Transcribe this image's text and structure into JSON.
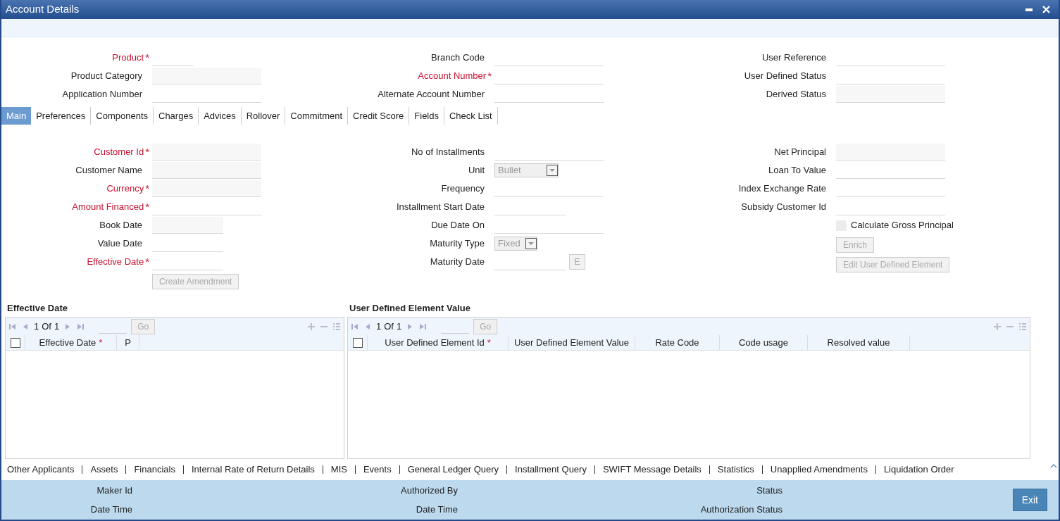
{
  "window": {
    "title": "Account Details"
  },
  "required_marker": "*",
  "header_fields": [
    [
      {
        "label": "Product",
        "required": true,
        "kind": "input"
      },
      {
        "label": "Product Category",
        "required": false,
        "kind": "readonly"
      },
      {
        "label": "Application Number",
        "required": false,
        "kind": "input"
      }
    ],
    [
      {
        "label": "Branch Code",
        "required": false,
        "kind": "input"
      },
      {
        "label": "Account Number",
        "required": true,
        "kind": "input"
      },
      {
        "label": "Alternate Account Number",
        "required": false,
        "kind": "input"
      }
    ],
    [
      {
        "label": "User Reference",
        "required": false,
        "kind": "input"
      },
      {
        "label": "User Defined Status",
        "required": false,
        "kind": "input"
      },
      {
        "label": "Derived Status",
        "required": false,
        "kind": "readonly"
      }
    ]
  ],
  "tabs": [
    {
      "label": "Main",
      "selected": true
    },
    {
      "label": "Preferences",
      "selected": false
    },
    {
      "label": "Components",
      "selected": false
    },
    {
      "label": "Charges",
      "selected": false
    },
    {
      "label": "Advices",
      "selected": false
    },
    {
      "label": "Rollover",
      "selected": false
    },
    {
      "label": "Commitment",
      "selected": false
    },
    {
      "label": "Credit Score",
      "selected": false
    },
    {
      "label": "Fields",
      "selected": false
    },
    {
      "label": "Check List",
      "selected": false
    }
  ],
  "main_fields": [
    [
      {
        "kind": "readonly",
        "label": "Customer Id",
        "required": true
      },
      {
        "kind": "readonly",
        "label": "Customer Name",
        "required": false
      },
      {
        "kind": "readonly",
        "label": "Currency",
        "required": true
      },
      {
        "kind": "input",
        "label": "Amount Financed",
        "required": true
      },
      {
        "kind": "readonly",
        "label": "Book Date",
        "required": false
      },
      {
        "kind": "input",
        "label": "Value Date",
        "required": false
      },
      {
        "kind": "input",
        "label": "Effective Date",
        "required": true
      },
      {
        "kind": "button",
        "label": "Create Amendment",
        "disabled": true
      }
    ],
    [
      {
        "kind": "input",
        "label": "No of Installments",
        "required": false
      },
      {
        "kind": "select",
        "label": "Unit",
        "required": false,
        "value": "Bullet"
      },
      {
        "kind": "input",
        "label": "Frequency",
        "required": false
      },
      {
        "kind": "input",
        "label": "Installment Start Date",
        "required": false
      },
      {
        "kind": "input",
        "label": "Due Date On",
        "required": false
      },
      {
        "kind": "select",
        "label": "Maturity Type",
        "required": false,
        "value": "Fixed"
      },
      {
        "kind": "input-button",
        "label": "Maturity Date",
        "required": false,
        "button": "E",
        "disabled": true
      }
    ],
    [
      {
        "kind": "readonly",
        "label": "Net Principal",
        "required": false
      },
      {
        "kind": "input",
        "label": "Loan To Value",
        "required": false
      },
      {
        "kind": "input",
        "label": "Index Exchange Rate",
        "required": false
      },
      {
        "kind": "input",
        "label": "Subsidy Customer Id",
        "required": false
      },
      {
        "kind": "checkbox",
        "label": "Calculate Gross Principal",
        "checked": false
      },
      {
        "kind": "button",
        "label": "Enrich",
        "disabled": true
      },
      {
        "kind": "button",
        "label": "Edit User Defined Element",
        "disabled": true
      }
    ]
  ],
  "grids": [
    {
      "title": "Effective Date",
      "all_checked": false,
      "pager": {
        "page": "1",
        "of": "Of",
        "total": "1"
      },
      "go": "Go",
      "columns": [
        {
          "label": "Effective Date",
          "required": true
        },
        {
          "label": "P",
          "required": false
        }
      ]
    },
    {
      "title": "User Defined Element Value",
      "all_checked": false,
      "pager": {
        "page": "1",
        "of": "Of",
        "total": "1"
      },
      "go": "Go",
      "columns": [
        {
          "label": "User Defined Element Id",
          "required": true
        },
        {
          "label": "User Defined Element Value",
          "required": false
        },
        {
          "label": "Rate Code",
          "required": false
        },
        {
          "label": "Code usage",
          "required": false
        },
        {
          "label": "Resolved value",
          "required": false
        }
      ]
    }
  ],
  "footer_links": [
    "Other Applicants",
    "Assets",
    "Financials",
    "Internal Rate of Return Details",
    "MIS",
    "Events",
    "General Ledger Query",
    "Installment Query",
    "SWIFT Message Details",
    "Statistics",
    "Unapplied Amendments",
    "Liquidation Order"
  ],
  "audit": [
    [
      "Maker Id",
      "Date Time"
    ],
    [
      "Authorized By",
      "Date Time"
    ],
    [
      "Status",
      "Authorization Status"
    ]
  ],
  "exit_button": "Exit"
}
